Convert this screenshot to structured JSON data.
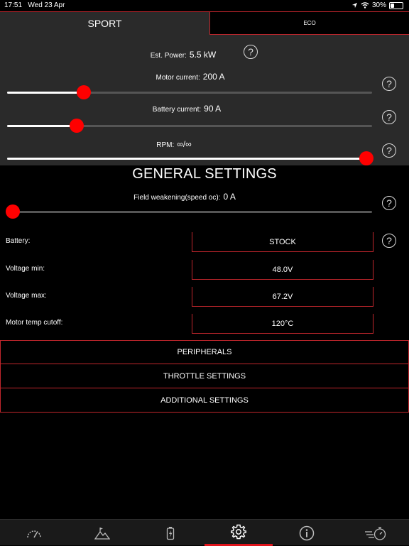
{
  "status": {
    "time": "17:51",
    "date": "Wed 23 Apr",
    "battery_pct": "30%",
    "battery_level": 0.3
  },
  "tabs": [
    {
      "label": "SPORT",
      "active": true
    },
    {
      "label": "ECO",
      "active": false
    }
  ],
  "sport": {
    "est_power_label": "Est. Power:",
    "est_power_value": "5.5 kW",
    "motor_label": "Motor current:",
    "motor_value": "200 A",
    "motor_level": 0.21,
    "battery_label": "Battery current:",
    "battery_value": "90 A",
    "battery_level": 0.19,
    "rpm_label": "RPM:",
    "rpm_value": "∞/∞",
    "rpm_level": 1.0
  },
  "general": {
    "title": "GENERAL SETTINGS",
    "fw_label": "Field weakening(speed oc):",
    "fw_value": "0 A",
    "fw_level": 0.0,
    "battery_label": "Battery:",
    "battery_value": "STOCK",
    "vmin_label": "Voltage min:",
    "vmin_value": "48.0V",
    "vmax_label": "Voltage max:",
    "vmax_value": "67.2V",
    "temp_label": "Motor temp cutoff:",
    "temp_value": "120°C"
  },
  "buttons": {
    "peripherals": "PERIPHERALS",
    "throttle": "THROTTLE SETTINGS",
    "additional": "ADDITIONAL SETTINGS"
  },
  "help_glyph": "?",
  "colors": {
    "accent": "#c0262c",
    "thumb": "#ff0000",
    "panel": "#2a2a2a"
  },
  "nav": [
    {
      "icon": "speedometer-icon"
    },
    {
      "icon": "mountain-flag-icon"
    },
    {
      "icon": "battery-icon"
    },
    {
      "icon": "gear-icon",
      "active": true
    },
    {
      "icon": "info-icon"
    },
    {
      "icon": "stopwatch-icon"
    }
  ]
}
